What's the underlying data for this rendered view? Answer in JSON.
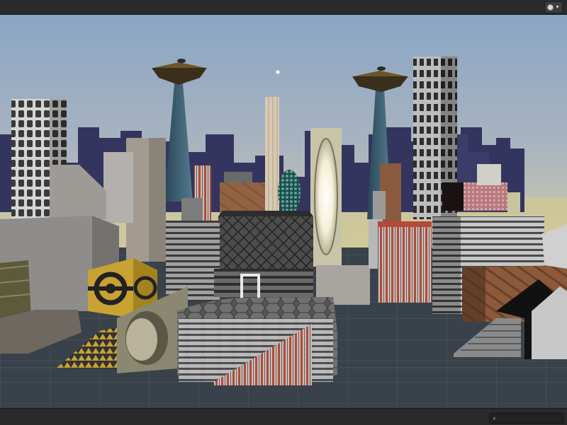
{
  "app": {
    "panel": "scene-view",
    "toolbar": {
      "gizmo_toggle_icon": "sphere-icon",
      "dropdown_icon": "chevron-down-icon"
    },
    "footer": {
      "search_icon": "magnifier-icon",
      "search_value": "",
      "search_placeholder": ""
    }
  },
  "scene": {
    "sky_top": "#8aa6c4",
    "sky_horizon": "#c9c9b0",
    "floor_color": "#3a434b",
    "skyline_color": "#2f2f5a",
    "objects": [
      "skyscraper-striped-left",
      "skyscraper-striped-right",
      "saucer-tower-left",
      "saucer-tower-right",
      "light-pillar",
      "portal-tower",
      "orb-cube",
      "cube-yellow-ring",
      "curved-ramp",
      "hexagon-rotunda",
      "stair-steps-right",
      "white-gate"
    ]
  }
}
